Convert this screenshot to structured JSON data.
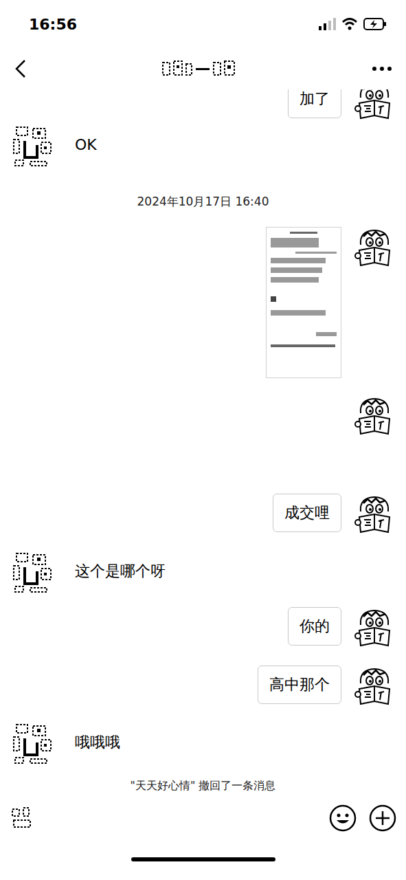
{
  "status_bar": {
    "time": "16:56"
  },
  "messages": [
    {
      "kind": "text",
      "side": "right",
      "text": "加了"
    },
    {
      "kind": "text",
      "side": "left",
      "text": "OK"
    },
    {
      "kind": "time",
      "text": "2024年10月17日 16:40"
    },
    {
      "kind": "image",
      "side": "right"
    },
    {
      "kind": "blank",
      "side": "right"
    },
    {
      "kind": "text",
      "side": "right",
      "text": "成交哩"
    },
    {
      "kind": "text",
      "side": "left",
      "text": "这个是哪个呀"
    },
    {
      "kind": "text",
      "side": "right",
      "text": "你的"
    },
    {
      "kind": "text",
      "side": "right",
      "text": "高中那个"
    },
    {
      "kind": "text",
      "side": "left",
      "text": "哦哦哦"
    },
    {
      "kind": "recall",
      "text": "\"天天好心情\" 撤回了一条消息"
    }
  ]
}
